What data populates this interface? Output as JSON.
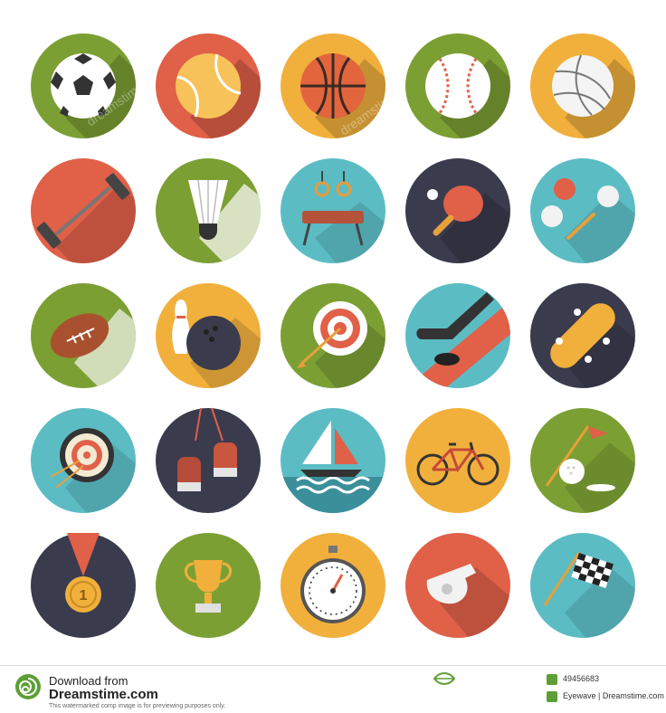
{
  "icons": [
    {
      "name": "soccer-ball-icon",
      "bg": "#7c9f34"
    },
    {
      "name": "tennis-ball-icon",
      "bg": "#e06048"
    },
    {
      "name": "basketball-icon",
      "bg": "#f1b03c"
    },
    {
      "name": "baseball-icon",
      "bg": "#7c9f34"
    },
    {
      "name": "volleyball-icon",
      "bg": "#f1b03c"
    },
    {
      "name": "barbell-icon",
      "bg": "#e06048"
    },
    {
      "name": "shuttlecock-icon",
      "bg": "#7c9f34"
    },
    {
      "name": "gymnastics-rings-icon",
      "bg": "#5cbcc4"
    },
    {
      "name": "ping-pong-paddle-icon",
      "bg": "#3b3b4e"
    },
    {
      "name": "billiards-icon",
      "bg": "#5cbcc4"
    },
    {
      "name": "american-football-icon",
      "bg": "#7c9f34"
    },
    {
      "name": "bowling-icon",
      "bg": "#f1b03c"
    },
    {
      "name": "archery-target-icon",
      "bg": "#7c9f34"
    },
    {
      "name": "hockey-stick-icon",
      "bg": "#5cbcc4"
    },
    {
      "name": "skateboard-icon",
      "bg": "#3b3b4e"
    },
    {
      "name": "dartboard-icon",
      "bg": "#5cbcc4"
    },
    {
      "name": "boxing-gloves-icon",
      "bg": "#3b3b4e"
    },
    {
      "name": "sailboat-icon",
      "bg": "#5cbcc4"
    },
    {
      "name": "bicycle-icon",
      "bg": "#f1b03c"
    },
    {
      "name": "golf-icon",
      "bg": "#7c9f34"
    },
    {
      "name": "medal-icon",
      "bg": "#3b3b4e"
    },
    {
      "name": "trophy-icon",
      "bg": "#7c9f34"
    },
    {
      "name": "stopwatch-icon",
      "bg": "#f1b03c"
    },
    {
      "name": "whistle-icon",
      "bg": "#e06048"
    },
    {
      "name": "checkered-flag-icon",
      "bg": "#5cbcc4"
    }
  ],
  "medal_label": "1",
  "watermark": {
    "text": "dreamstime"
  },
  "footer": {
    "download_from": "Download from",
    "site": "Dreamstime.com",
    "disclaimer": "This watermarked comp image is for previewing purposes only.",
    "image_id": "49456683",
    "credit": "Eyewave | Dreamstime.com"
  },
  "colors": {
    "green": "#7c9f34",
    "red": "#e06048",
    "yellow": "#f1b03c",
    "teal": "#5cbcc4",
    "navy": "#3b3b4e",
    "dreamstime_green": "#5d9f36"
  }
}
